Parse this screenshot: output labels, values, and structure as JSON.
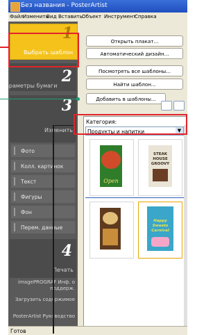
{
  "window": {
    "title": "Без названия - PosterArtist"
  },
  "menu": [
    "Файл",
    "Изменить",
    "Вид",
    "Вставить",
    "Объект",
    "Инструмент",
    "Справка"
  ],
  "steps": [
    {
      "num": "1",
      "label": "Выбрать шаблон"
    },
    {
      "num": "2",
      "label": "Параметры бумаги"
    },
    {
      "num": "3",
      "label": "Изменить"
    },
    {
      "num": "4",
      "label": "Печать"
    }
  ],
  "edit_items": [
    "Фото",
    "Колл. картинок",
    "Текст",
    "Фигуры",
    "Фон",
    "Перем. данные"
  ],
  "print_links": [
    "imagePROGRAF Инф. о поддерж.",
    "Загрузить содержимое",
    "PosterArtist Руководство"
  ],
  "buttons": [
    "Открыть плакат...",
    "Автоматический дизайн...",
    "Посмотреть все шаблоны...",
    "Найти шаблон...",
    "Добавить в шаблоны..."
  ],
  "category": {
    "label": "Категория:",
    "value": "Продукты и напитки"
  },
  "thumbnails": [
    {
      "title": "Open",
      "bg": "#2f7d2a"
    },
    {
      "title": "STEAK HOUSE GROOVY",
      "bg": "#e9e4d6"
    },
    {
      "title": "",
      "bg": "#5e3a1e"
    },
    {
      "title": "Happy Sweets Carnival",
      "bg": "#3aa6c9"
    }
  ],
  "status": "Готов",
  "colors": {
    "accent": "#f4c21b",
    "highlight_box": "#e2232a",
    "callout_green": "#1f9c74",
    "panel_dark": "#5a5a5a"
  }
}
